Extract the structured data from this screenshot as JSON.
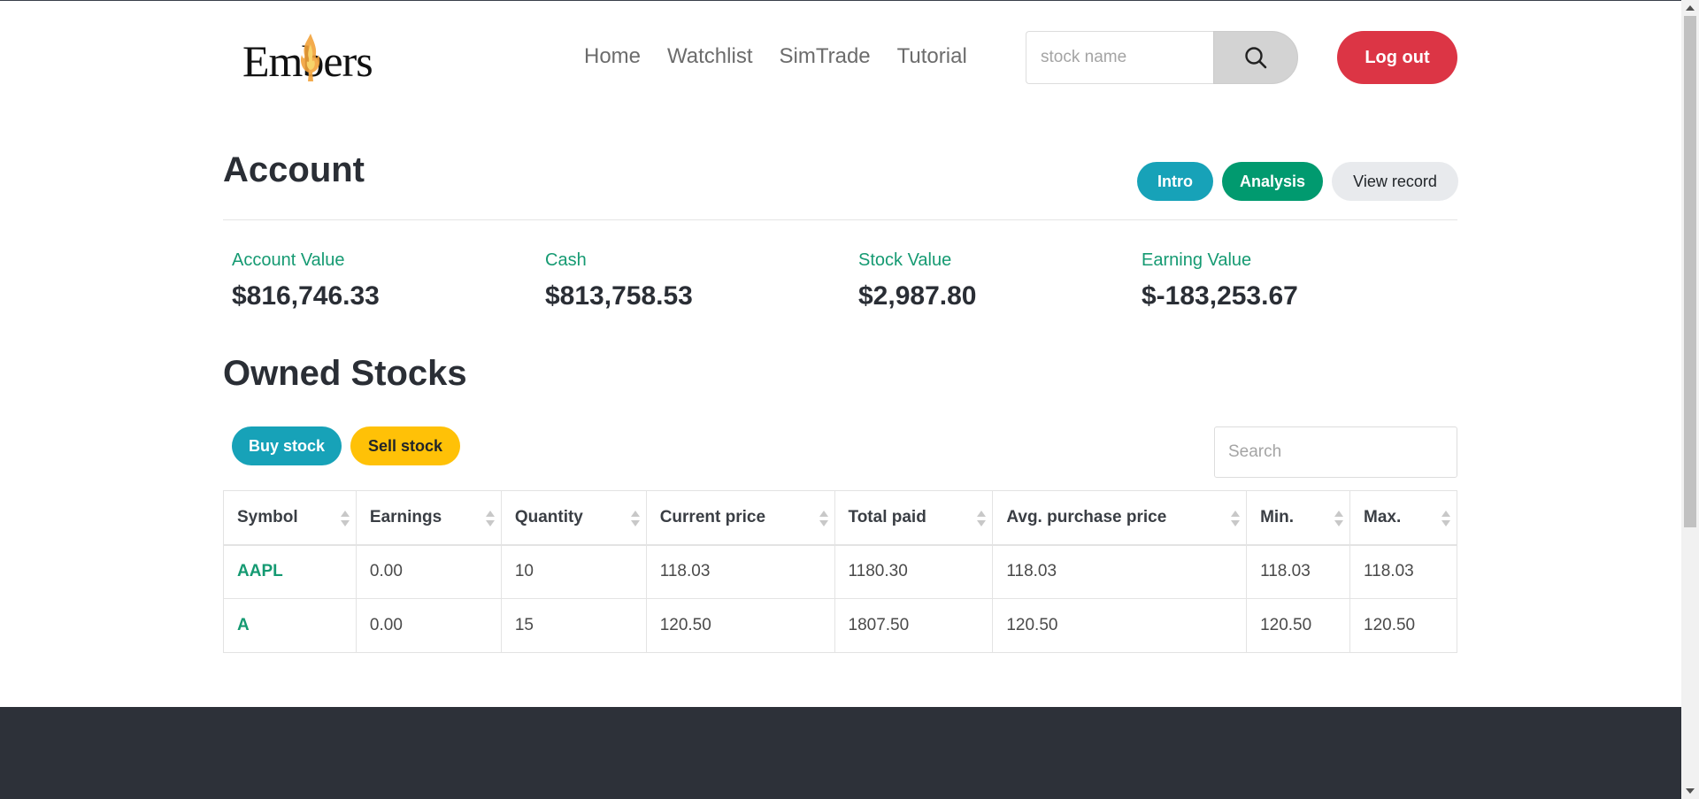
{
  "brand": {
    "name": "Embers",
    "icon": "flame-icon"
  },
  "nav": {
    "links": [
      {
        "label": "Home"
      },
      {
        "label": "Watchlist"
      },
      {
        "label": "SimTrade"
      },
      {
        "label": "Tutorial"
      }
    ],
    "search_placeholder": "stock name",
    "search_icon": "search-icon",
    "logout_label": "Log out"
  },
  "account": {
    "title": "Account",
    "buttons": {
      "intro": "Intro",
      "analysis": "Analysis",
      "view_record": "View record"
    },
    "stats": [
      {
        "label": "Account Value",
        "value": "$816,746.33"
      },
      {
        "label": "Cash",
        "value": "$813,758.53"
      },
      {
        "label": "Stock Value",
        "value": "$2,987.80"
      },
      {
        "label": "Earning Value",
        "value": "$-183,253.67"
      }
    ]
  },
  "owned": {
    "title": "Owned Stocks",
    "buy_label": "Buy stock",
    "sell_label": "Sell stock",
    "search_placeholder": "Search",
    "columns": [
      "Symbol",
      "Earnings",
      "Quantity",
      "Current price",
      "Total paid",
      "Avg. purchase price",
      "Min.",
      "Max."
    ],
    "rows": [
      [
        "AAPL",
        "0.00",
        "10",
        "118.03",
        "1180.30",
        "118.03",
        "118.03",
        "118.03"
      ],
      [
        "A",
        "0.00",
        "15",
        "120.50",
        "1807.50",
        "120.50",
        "120.50",
        "120.50"
      ]
    ]
  },
  "colors": {
    "accent_green": "#159a72",
    "info": "#17a2b8",
    "danger": "#dc3545",
    "warning": "#ffc107",
    "footer": "#2d3139"
  }
}
